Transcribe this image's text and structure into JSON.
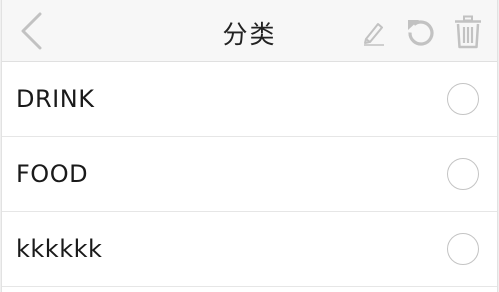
{
  "header": {
    "title": "分类",
    "back_icon": "chevron-left-icon",
    "actions": [
      {
        "icon": "pencil-icon",
        "name": "edit-button"
      },
      {
        "icon": "undo-icon",
        "name": "refresh-button"
      },
      {
        "icon": "trash-icon",
        "name": "delete-button"
      }
    ]
  },
  "categories": [
    {
      "label": "DRINK",
      "selected": false
    },
    {
      "label": "FOOD",
      "selected": false
    },
    {
      "label": "kkkkkk",
      "selected": false
    }
  ],
  "colors": {
    "navbar_bg": "#f7f7f7",
    "icon_gray": "#c2c2c2",
    "text": "#1a1a1a",
    "divider": "#e6e6e6"
  }
}
